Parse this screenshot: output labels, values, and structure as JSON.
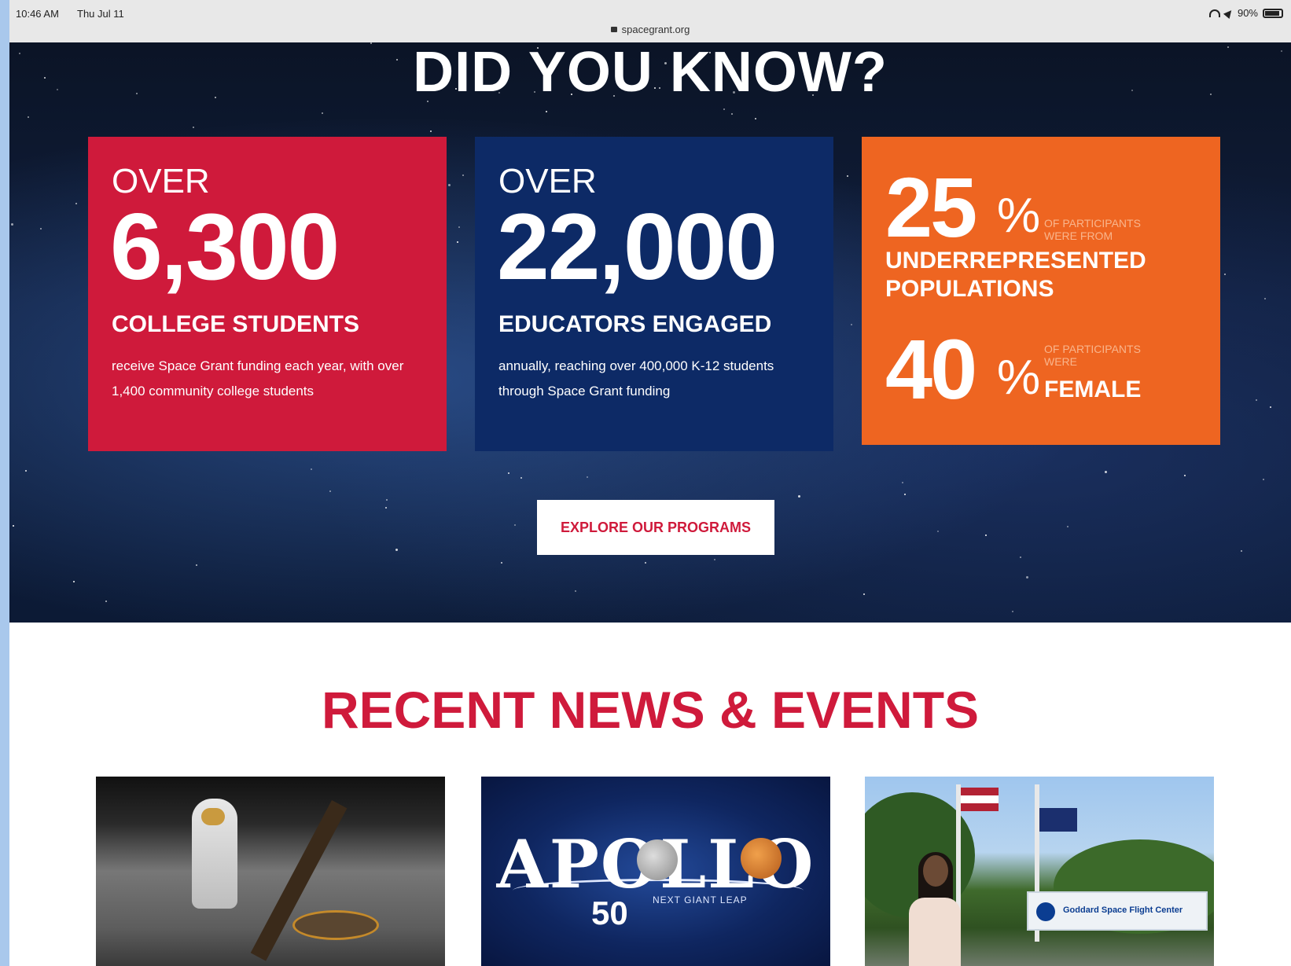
{
  "status_bar": {
    "time": "10:46 AM",
    "date": "Thu Jul 11",
    "url": "spacegrant.org",
    "battery": "90%"
  },
  "hero": {
    "title": "DID YOU KNOW?",
    "cards": [
      {
        "prefix": "OVER",
        "number": "6,300",
        "heading": "COLLEGE STUDENTS",
        "description": "receive Space Grant funding each year, with over 1,400 community college students",
        "color": "#cf1a3b"
      },
      {
        "prefix": "OVER",
        "number": "22,000",
        "heading": "EDUCATORS ENGAGED",
        "description": "annually, reaching over 400,000 K-12 students through Space Grant funding",
        "color": "#0d2a66"
      }
    ],
    "stats_card": {
      "color": "#ee6521",
      "stat1": {
        "number": "25",
        "percent": "%",
        "small": "OF PARTICIPANTS WERE FROM",
        "heading": "UNDERREPRESENTED POPULATIONS"
      },
      "stat2": {
        "number": "40",
        "percent": "%",
        "small": "OF PARTICIPANTS WERE",
        "heading": "FEMALE"
      }
    },
    "cta_label": "EXPLORE OUR PROGRAMS"
  },
  "news": {
    "title": "RECENT NEWS & EVENTS",
    "apollo_logo": {
      "text": "APOLLO",
      "number": "50",
      "tagline": "NEXT GIANT LEAP"
    },
    "sign_text": "Goddard Space Flight Center"
  },
  "colors": {
    "accent_red": "#cf1a3b",
    "navy": "#0d2a66",
    "orange": "#ee6521"
  }
}
